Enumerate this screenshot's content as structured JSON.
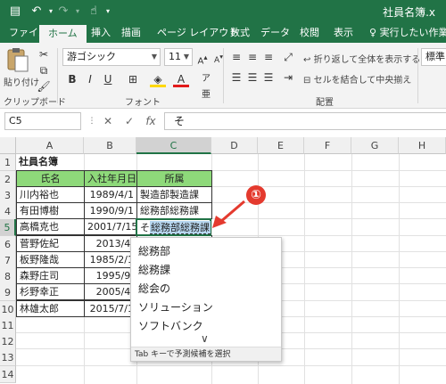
{
  "window": {
    "title": "社員名簿.x"
  },
  "tabs": [
    "ファイル",
    "ホーム",
    "挿入",
    "描画",
    "ページ レイアウト",
    "数式",
    "データ",
    "校閲",
    "表示"
  ],
  "tell_me": "実行したい作業を入",
  "ribbon": {
    "paste_label": "貼り付け",
    "clipboard_label": "クリップボード",
    "font_label": "フォント",
    "alignment_label": "配置",
    "font_name": "游ゴシック",
    "font_size": "11",
    "wrap_text": "折り返して全体を表示する",
    "merge_center": "セルを結合して中央揃え",
    "number_format": "標準"
  },
  "formula_bar": {
    "name_box": "C5",
    "formula": "そ",
    "fx": "fx"
  },
  "grid": {
    "columns": [
      "A",
      "B",
      "C",
      "D",
      "E",
      "F",
      "G",
      "H"
    ],
    "rows": [
      "1",
      "2",
      "3",
      "4",
      "5",
      "6",
      "7",
      "8",
      "9",
      "10",
      "11",
      "12",
      "13",
      "14"
    ],
    "title": "社員名簿",
    "headers": [
      "氏名",
      "入社年月日",
      "所属"
    ],
    "names": [
      "川内裕也",
      "有田博樹",
      "高橋克也",
      "菅野佐紀",
      "板野隆哉",
      "森野庄司",
      "杉野幸正",
      "林雄太郎"
    ],
    "dates": [
      "1989/4/1",
      "1990/9/1",
      "2001/7/15",
      "2013/4/",
      "1985/2/1",
      "1995/9/",
      "2005/4/",
      "2015/7/1"
    ],
    "depts": [
      "製造部製造課",
      "総務部総務課"
    ],
    "c5_typed": "そ",
    "c5_suggestion": "総務部総務課"
  },
  "callout": {
    "badge": "①"
  },
  "autocomplete": {
    "items": [
      "総務部",
      "総務課",
      "総会の",
      "ソリューション",
      "ソフトバンク"
    ],
    "more": "∨",
    "footer": "Tab キーで予測候補を選択"
  }
}
